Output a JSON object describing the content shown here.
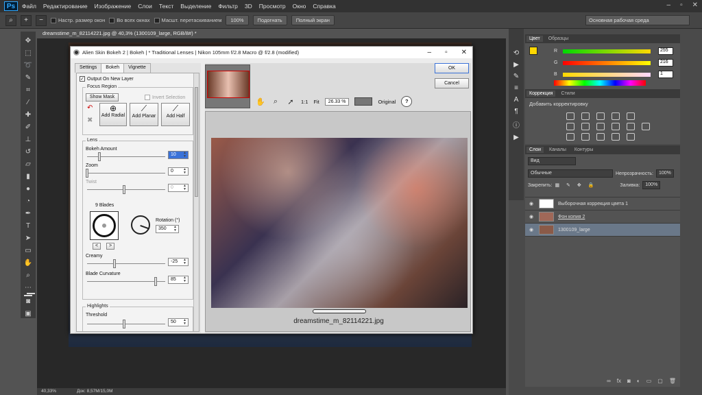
{
  "menu": {
    "logo": "Ps",
    "items": [
      "Файл",
      "Редактирование",
      "Изображение",
      "Слои",
      "Текст",
      "Выделение",
      "Фильтр",
      "3D",
      "Просмотр",
      "Окно",
      "Справка"
    ]
  },
  "options": {
    "resize": "Настр. размер окон",
    "allwin": "Во всех окнах",
    "scrubby": "Масшт. перетаскиванием",
    "zoom": "100%",
    "fit": "Подогнать",
    "full": "Полный экран",
    "workspace": "Основная рабочая среда"
  },
  "doc": {
    "tab": "dreamstime_m_82114221.jpg @ 40,3% (1300109_large, RGB/8#) *",
    "zoom": "40,33%",
    "docsize": "Док: 8,57M/15,0M"
  },
  "dialog": {
    "title": "Alien Skin Bokeh 2 | Bokeh | * Traditional Lenses | Nikon 105mm f/2.8 Macro @ f/2.8 (modified)",
    "tabs": [
      "Settings",
      "Bokeh",
      "Vignette"
    ],
    "output_new_layer": "Output On New Layer",
    "focus_region": "Focus Region",
    "show_mask": "Show Mask",
    "invert_selection": "Invert Selection",
    "add_radial": "Add Radial",
    "add_planar": "Add Planar",
    "add_half": "Add Half",
    "lens": "Lens",
    "bokeh_amount": "Bokeh Amount",
    "bokeh_amount_val": "10",
    "zoom": "Zoom",
    "zoom_val": "0",
    "twist": "Twist",
    "twist_val": "0",
    "blades": "9 Blades",
    "rotation": "Rotation (°)",
    "rotation_val": "350",
    "prev": "<",
    "next": ">",
    "creamy": "Creamy",
    "creamy_val": "-25",
    "blade_curvature": "Blade Curvature",
    "blade_curvature_val": "85",
    "highlights": "Highlights",
    "threshold": "Threshold",
    "threshold_val": "50",
    "ok": "OK",
    "cancel": "Cancel",
    "ratio": "1:1",
    "fit": "Fit",
    "zoom_pct": "26.33 %",
    "original": "Original",
    "help": "?",
    "filename": "dreamstime_m_82114221.jpg"
  },
  "color_panel": {
    "tabs": [
      "Цвет",
      "Образцы"
    ],
    "r_label": "R",
    "g_label": "G",
    "b_label": "B",
    "r": "255",
    "g": "216",
    "b": "1",
    "fg": "#ffd801"
  },
  "adj_panel": {
    "tabs": [
      "Коррекция",
      "Стили"
    ],
    "add": "Добавить корректировку"
  },
  "layers_panel": {
    "tabs": [
      "Слои",
      "Каналы",
      "Контуры"
    ],
    "kind": "Вид",
    "blend": "Обычные",
    "opacity_label": "Непрозрачность:",
    "opacity": "100%",
    "lock_label": "Закрепить:",
    "fill_label": "Заливка:",
    "fill": "100%",
    "layers": [
      {
        "name": "Выборочная коррекция цвета 1"
      },
      {
        "name": "Фон копия 2"
      },
      {
        "name": "1300109_large"
      }
    ]
  }
}
